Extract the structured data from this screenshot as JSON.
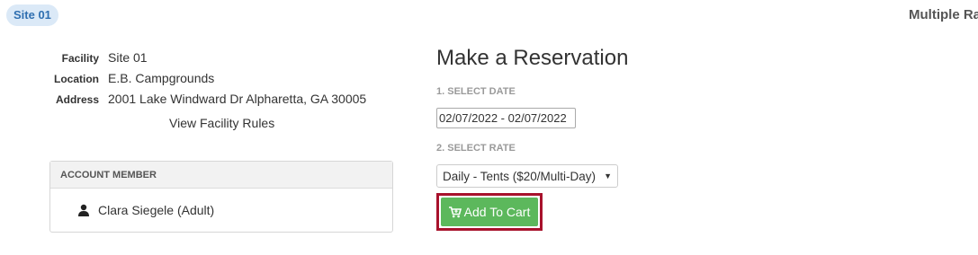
{
  "header": {
    "site_badge": "Site 01",
    "right_title": "Multiple Rat"
  },
  "facility": {
    "facility_label": "Facility",
    "facility_value": "Site 01",
    "location_label": "Location",
    "location_value": "E.B. Campgrounds",
    "address_label": "Address",
    "address_value": "2001 Lake Windward Dr Alpharetta, GA 30005",
    "rules_link": "View Facility Rules"
  },
  "account": {
    "header": "ACCOUNT MEMBER",
    "member_name": "Clara Siegele (Adult)",
    "icon": "person-icon"
  },
  "reservation": {
    "title": "Make a Reservation",
    "step1_label": "1. SELECT DATE",
    "date_value": "02/07/2022 - 02/07/2022",
    "step2_label": "2. SELECT RATE",
    "rate_selected": "Daily - Tents ($20/Multi-Day)",
    "add_to_cart": "Add To Cart",
    "cart_icon": "cart-icon",
    "highlight_color": "#a8122c",
    "button_color": "#5cb85c"
  }
}
